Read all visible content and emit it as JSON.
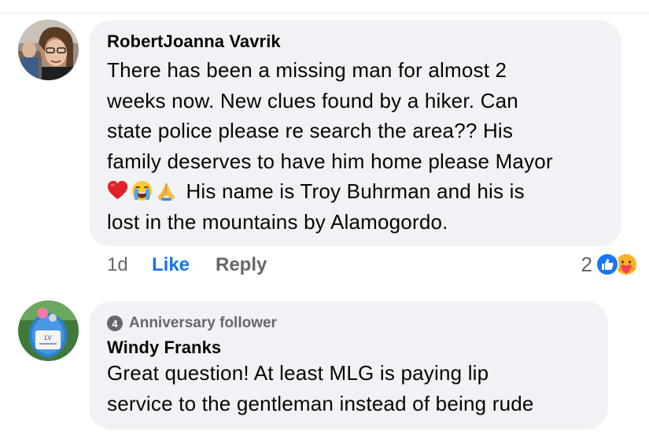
{
  "comments": [
    {
      "author": "RobertJoanna Vavrik",
      "lines": [
        "There has been a missing man for almost 2",
        "weeks now. New clues found by a hiker. Can",
        "state police please re search the area?? His",
        "family deserves to have him home please Mayor"
      ],
      "line5_text": "His name is Troy Buhrman and his is",
      "line6": "lost in the mountains by Alamogordo.",
      "inline_emojis": [
        "red-heart",
        "loudly-crying-face",
        "folded-hands"
      ],
      "time": "1d",
      "like_label": "Like",
      "reply_label": "Reply",
      "reaction_count": "2",
      "reactions": [
        "like",
        "care"
      ]
    },
    {
      "badge_number": "4",
      "badge_label": "Anniversary follower",
      "author": "Windy Franks",
      "lines": [
        "Great question!  At least MLG is paying lip",
        "service to the gentleman instead of being rude"
      ]
    }
  ],
  "colors": {
    "bubble": "#f0f2f5",
    "text": "#050505",
    "secondary": "#65676b",
    "like_blue": "#1a73e8"
  }
}
